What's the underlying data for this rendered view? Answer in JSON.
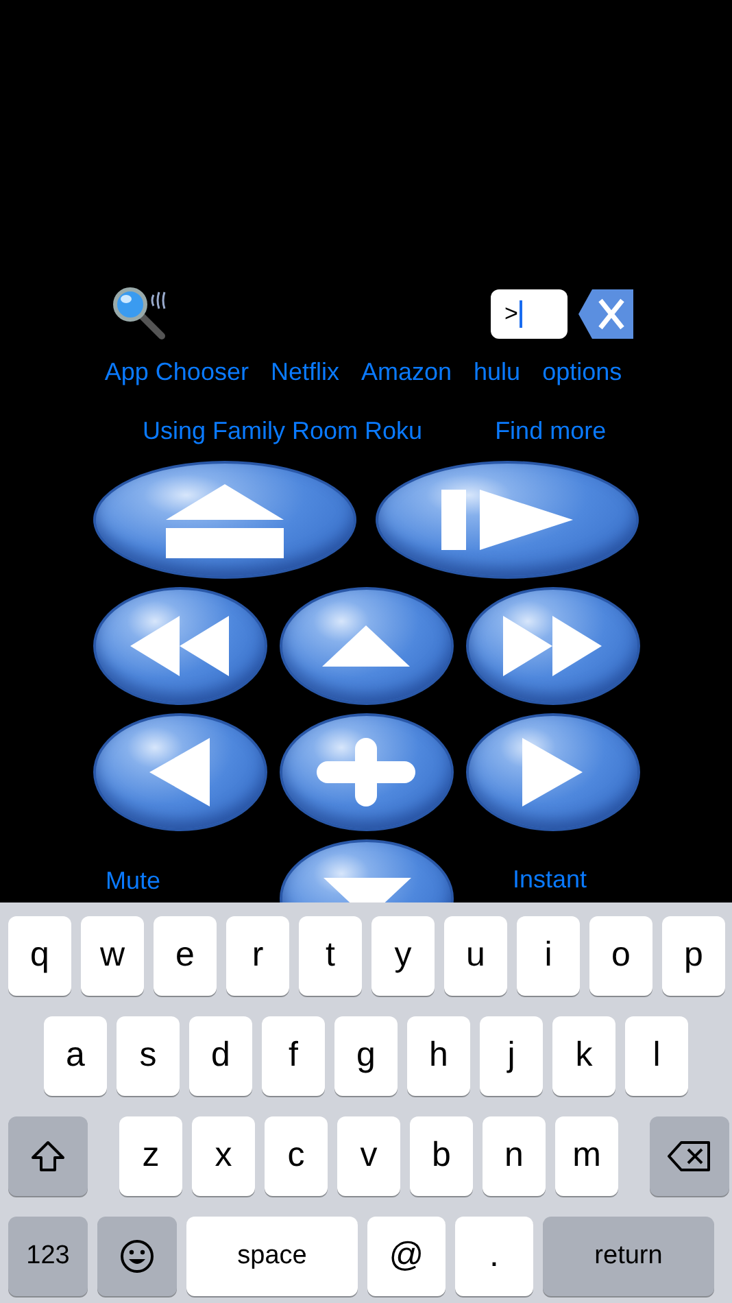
{
  "top_bar": {
    "field": {
      "value": ">"
    }
  },
  "links": [
    {
      "label": "App Chooser"
    },
    {
      "label": "Netflix"
    },
    {
      "label": "Amazon"
    },
    {
      "label": "hulu"
    },
    {
      "label": "options"
    }
  ],
  "device": {
    "status": "Using Family Room Roku",
    "find_more": "Find more"
  },
  "remote_rows": [
    {
      "buttons": [
        {
          "kind": "home"
        },
        {
          "kind": "play-pause"
        }
      ]
    },
    {
      "buttons": [
        {
          "kind": "rewind"
        },
        {
          "kind": "up"
        },
        {
          "kind": "fast-forward"
        }
      ]
    },
    {
      "buttons": [
        {
          "kind": "left"
        },
        {
          "kind": "select"
        },
        {
          "kind": "right"
        }
      ]
    }
  ],
  "bottom_row": {
    "left_label": "Mute",
    "button": {
      "kind": "down"
    },
    "right_label": "Instant"
  },
  "keyboard": {
    "rows": [
      {
        "keys": [
          {
            "kind": "letter",
            "label": "q"
          },
          {
            "kind": "letter",
            "label": "w"
          },
          {
            "kind": "letter",
            "label": "e"
          },
          {
            "kind": "letter",
            "label": "r"
          },
          {
            "kind": "letter",
            "label": "t"
          },
          {
            "kind": "letter",
            "label": "y"
          },
          {
            "kind": "letter",
            "label": "u"
          },
          {
            "kind": "letter",
            "label": "i"
          },
          {
            "kind": "letter",
            "label": "o"
          },
          {
            "kind": "letter",
            "label": "p"
          }
        ]
      },
      {
        "keys": [
          {
            "kind": "letter",
            "label": "a"
          },
          {
            "kind": "letter",
            "label": "s"
          },
          {
            "kind": "letter",
            "label": "d"
          },
          {
            "kind": "letter",
            "label": "f"
          },
          {
            "kind": "letter",
            "label": "g"
          },
          {
            "kind": "letter",
            "label": "h"
          },
          {
            "kind": "letter",
            "label": "j"
          },
          {
            "kind": "letter",
            "label": "k"
          },
          {
            "kind": "letter",
            "label": "l"
          }
        ]
      },
      {
        "keys": [
          {
            "kind": "shift"
          },
          {
            "kind": "letter",
            "label": "z"
          },
          {
            "kind": "letter",
            "label": "x"
          },
          {
            "kind": "letter",
            "label": "c"
          },
          {
            "kind": "letter",
            "label": "v"
          },
          {
            "kind": "letter",
            "label": "b"
          },
          {
            "kind": "letter",
            "label": "n"
          },
          {
            "kind": "letter",
            "label": "m"
          },
          {
            "kind": "delete"
          }
        ]
      },
      {
        "keys": [
          {
            "kind": "mode",
            "label": "123"
          },
          {
            "kind": "emoji"
          },
          {
            "kind": "space",
            "label": "space"
          },
          {
            "kind": "letter",
            "label": "@"
          },
          {
            "kind": "letter",
            "label": "."
          },
          {
            "kind": "return",
            "label": "return"
          }
        ]
      }
    ]
  }
}
